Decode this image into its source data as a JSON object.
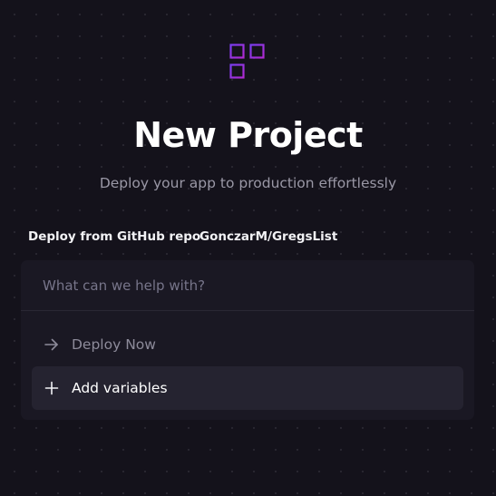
{
  "header": {
    "logo_icon": "add-grid-icon",
    "title": "New Project",
    "subtitle": "Deploy your app to production effortlessly"
  },
  "source": {
    "method": "Deploy from GitHub repo",
    "repo": "GonczarM/GregsList"
  },
  "prompt": {
    "placeholder": "What can we help with?",
    "value": ""
  },
  "actions": [
    {
      "label": "Deploy Now",
      "icon": "arrow-right-icon"
    },
    {
      "label": "Add variables",
      "icon": "plus-icon"
    }
  ],
  "colors": {
    "background": "#14121b",
    "panel": "#1a1823",
    "accent": "#8a2be2",
    "muted_text": "#9a98a6"
  }
}
